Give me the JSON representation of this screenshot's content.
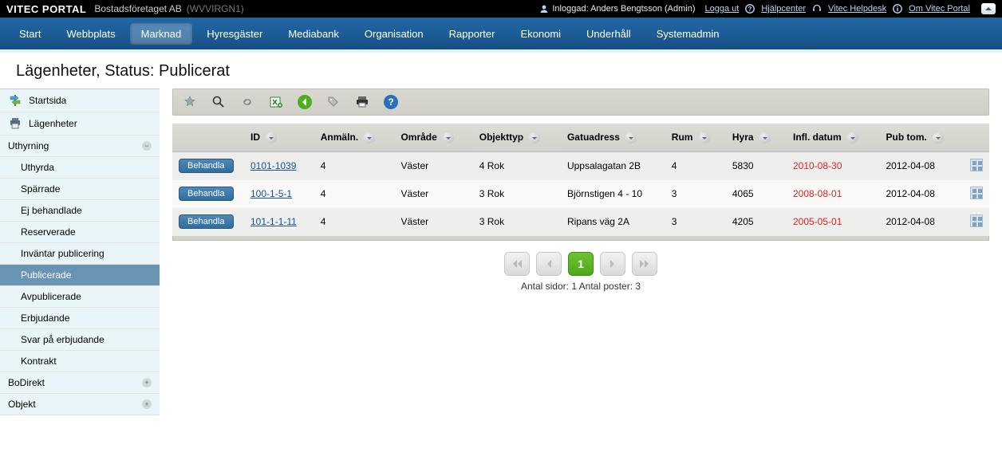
{
  "top": {
    "brand": "VITEC PORTAL",
    "company": "Bostadsföretaget AB",
    "env": "(WVVIRGN1)",
    "user_label": "Inloggad: Anders Bengtsson (Admin)",
    "logout": "Logga ut",
    "helpcenter": "Hjälpcenter",
    "helpdesk": "Vitec Helpdesk",
    "about": "Om Vitec Portal"
  },
  "nav": {
    "items": [
      "Start",
      "Webbplats",
      "Marknad",
      "Hyresgäster",
      "Mediabank",
      "Organisation",
      "Rapporter",
      "Ekonomi",
      "Underhåll",
      "Systemadmin"
    ],
    "active_index": 2
  },
  "page_title": "Lägenheter, Status: Publicerat",
  "sidebar": {
    "top": [
      {
        "label": "Startsida",
        "icon": "signpost"
      },
      {
        "label": "Lägenheter",
        "icon": "printer"
      }
    ],
    "groups": [
      {
        "label": "Uthyrning",
        "expanded": true,
        "items": [
          "Uthyrda",
          "Spärrade",
          "Ej behandlade",
          "Reserverade",
          "Inväntar publicering",
          "Publicerade",
          "Avpublicerade",
          "Erbjudande",
          "Svar på erbjudande",
          "Kontrakt"
        ],
        "selected_index": 5
      },
      {
        "label": "BoDirekt",
        "expanded": false,
        "items": []
      },
      {
        "label": "Objekt",
        "expanded": false,
        "items": []
      }
    ]
  },
  "columns": {
    "behandla_heading": "",
    "id": "ID",
    "anmalan": "Anmäln.",
    "omrade": "Område",
    "objekttyp": "Objekttyp",
    "gatuadress": "Gatuadress",
    "rum": "Rum",
    "hyra": "Hyra",
    "infl_datum": "Infl. datum",
    "pub_tom": "Pub tom."
  },
  "behandla_label": "Behandla",
  "rows": [
    {
      "id": "0101-1039",
      "anmalan": "4",
      "omrade": "Väster",
      "objekttyp": "4 Rok",
      "gatuadress": "Uppsalagatan 2B",
      "rum": "4",
      "hyra": "5830",
      "infl": "2010-08-30",
      "pub": "2012-04-08"
    },
    {
      "id": "100-1-5-1",
      "anmalan": "4",
      "omrade": "Väster",
      "objekttyp": "3 Rok",
      "gatuadress": "Björnstigen 4 - 10",
      "rum": "3",
      "hyra": "4065",
      "infl": "2008-08-01",
      "pub": "2012-04-08"
    },
    {
      "id": "101-1-1-11",
      "anmalan": "4",
      "omrade": "Väster",
      "objekttyp": "3 Rok",
      "gatuadress": "Ripans väg 2A",
      "rum": "3",
      "hyra": "4205",
      "infl": "2005-05-01",
      "pub": "2012-04-08"
    }
  ],
  "pager": {
    "current": "1",
    "info": "Antal sidor: 1 Antal poster: 3"
  }
}
